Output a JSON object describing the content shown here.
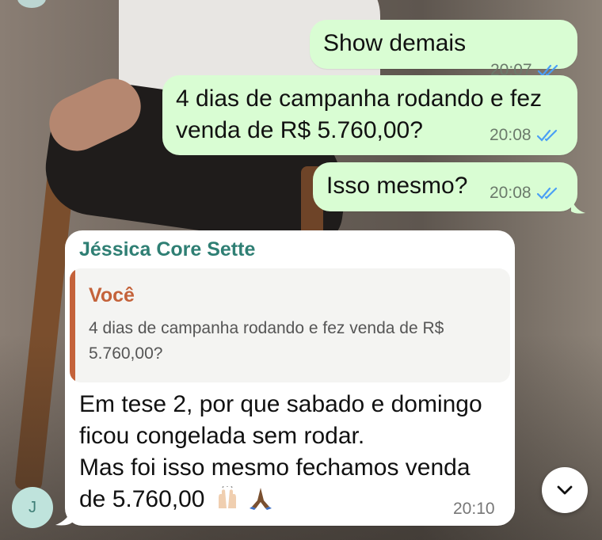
{
  "chat": {
    "outgoing": [
      {
        "text": "Show demais",
        "time": "20:07"
      },
      {
        "text": "4 dias de campanha rodando e fez venda de R$ 5.760,00?",
        "time": "20:08"
      },
      {
        "text": "Isso mesmo?",
        "time": "20:08"
      }
    ],
    "incoming": {
      "sender": "Jéssica Core Sette",
      "quote_author": "Você",
      "quote_text": "4 dias de campanha rodando e fez venda de R$ 5.760,00?",
      "line1": "Em tese 2, por que sabado e domingo",
      "line2": "ficou congelada sem rodar.",
      "line3": "Mas foi isso mesmo fechamos venda",
      "line4": "de 5.760,00",
      "emojis": [
        "raising-hands-icon",
        "folded-hands-icon"
      ],
      "time": "20:10"
    },
    "avatar_initial": "J"
  },
  "colors": {
    "outgoing_bubble": "#d9fdd3",
    "incoming_bubble": "#ffffff",
    "sender_name": "#2f7f74",
    "quote_author": "#c4623a",
    "read_ticks": "#4a9ff5"
  },
  "icons": {
    "read_receipt": "double-check-icon",
    "scroll_down": "chevron-down-icon"
  }
}
